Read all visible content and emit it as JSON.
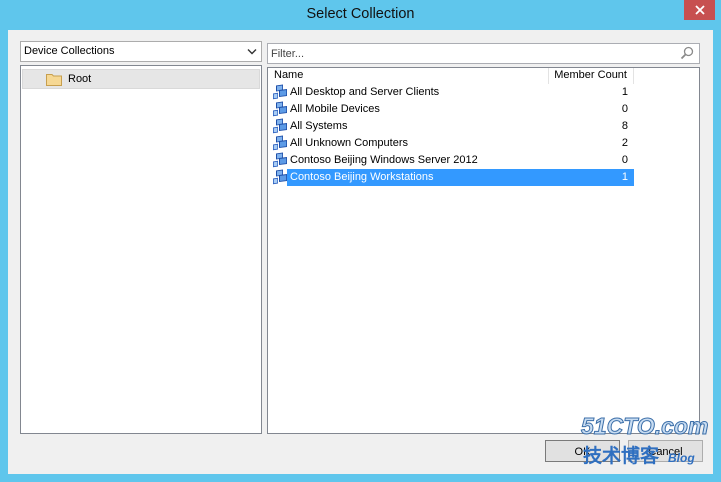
{
  "window": {
    "title": "Select Collection",
    "colors": {
      "frame": "#5fc6ec",
      "close_button": "#c75050",
      "client": "#f0f0f0",
      "selection": "#3399ff"
    }
  },
  "left": {
    "dropdown": {
      "selected": "Device Collections",
      "icon": "chevron-down-icon"
    },
    "tree": {
      "items": [
        {
          "label": "Root",
          "icon": "folder-icon",
          "selected": true
        }
      ]
    }
  },
  "right": {
    "filter": {
      "value": "",
      "placeholder": "Filter...",
      "icon": "search-icon"
    },
    "list": {
      "columns": {
        "name": "Name",
        "member_count": "Member Count"
      },
      "row_icon": "device-collection-icon",
      "selected_index": 5,
      "rows": [
        {
          "name": "All Desktop and Server Clients",
          "member_count": 1
        },
        {
          "name": "All Mobile Devices",
          "member_count": 0
        },
        {
          "name": "All Systems",
          "member_count": 8
        },
        {
          "name": "All Unknown Computers",
          "member_count": 2
        },
        {
          "name": "Contoso Beijing Windows Server 2012",
          "member_count": 0
        },
        {
          "name": "Contoso Beijing Workstations",
          "member_count": 1
        }
      ]
    }
  },
  "buttons": {
    "ok": "OK",
    "cancel": "Cancel"
  },
  "watermark": {
    "brand": "51CTO.com",
    "subtitle": "技术博客",
    "tag": "Blog"
  }
}
